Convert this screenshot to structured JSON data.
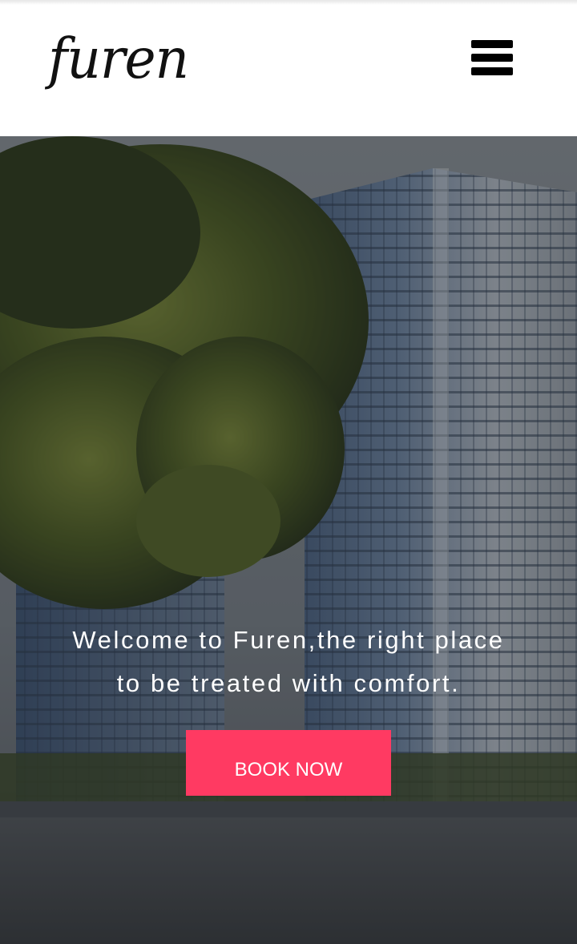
{
  "header": {
    "logo_text": "furen",
    "menu_icon": "hamburger-menu-icon"
  },
  "hero": {
    "background_image": "hotel-building-with-tree",
    "welcome_line1": "Welcome to Furen,the right place",
    "welcome_line2": "to be treated with comfort.",
    "book_button_label": "BOOK NOW"
  },
  "colors": {
    "accent": "#ff3a62",
    "header_background": "#ffffff",
    "menu_icon": "#000000",
    "hero_text": "#ffffff"
  }
}
